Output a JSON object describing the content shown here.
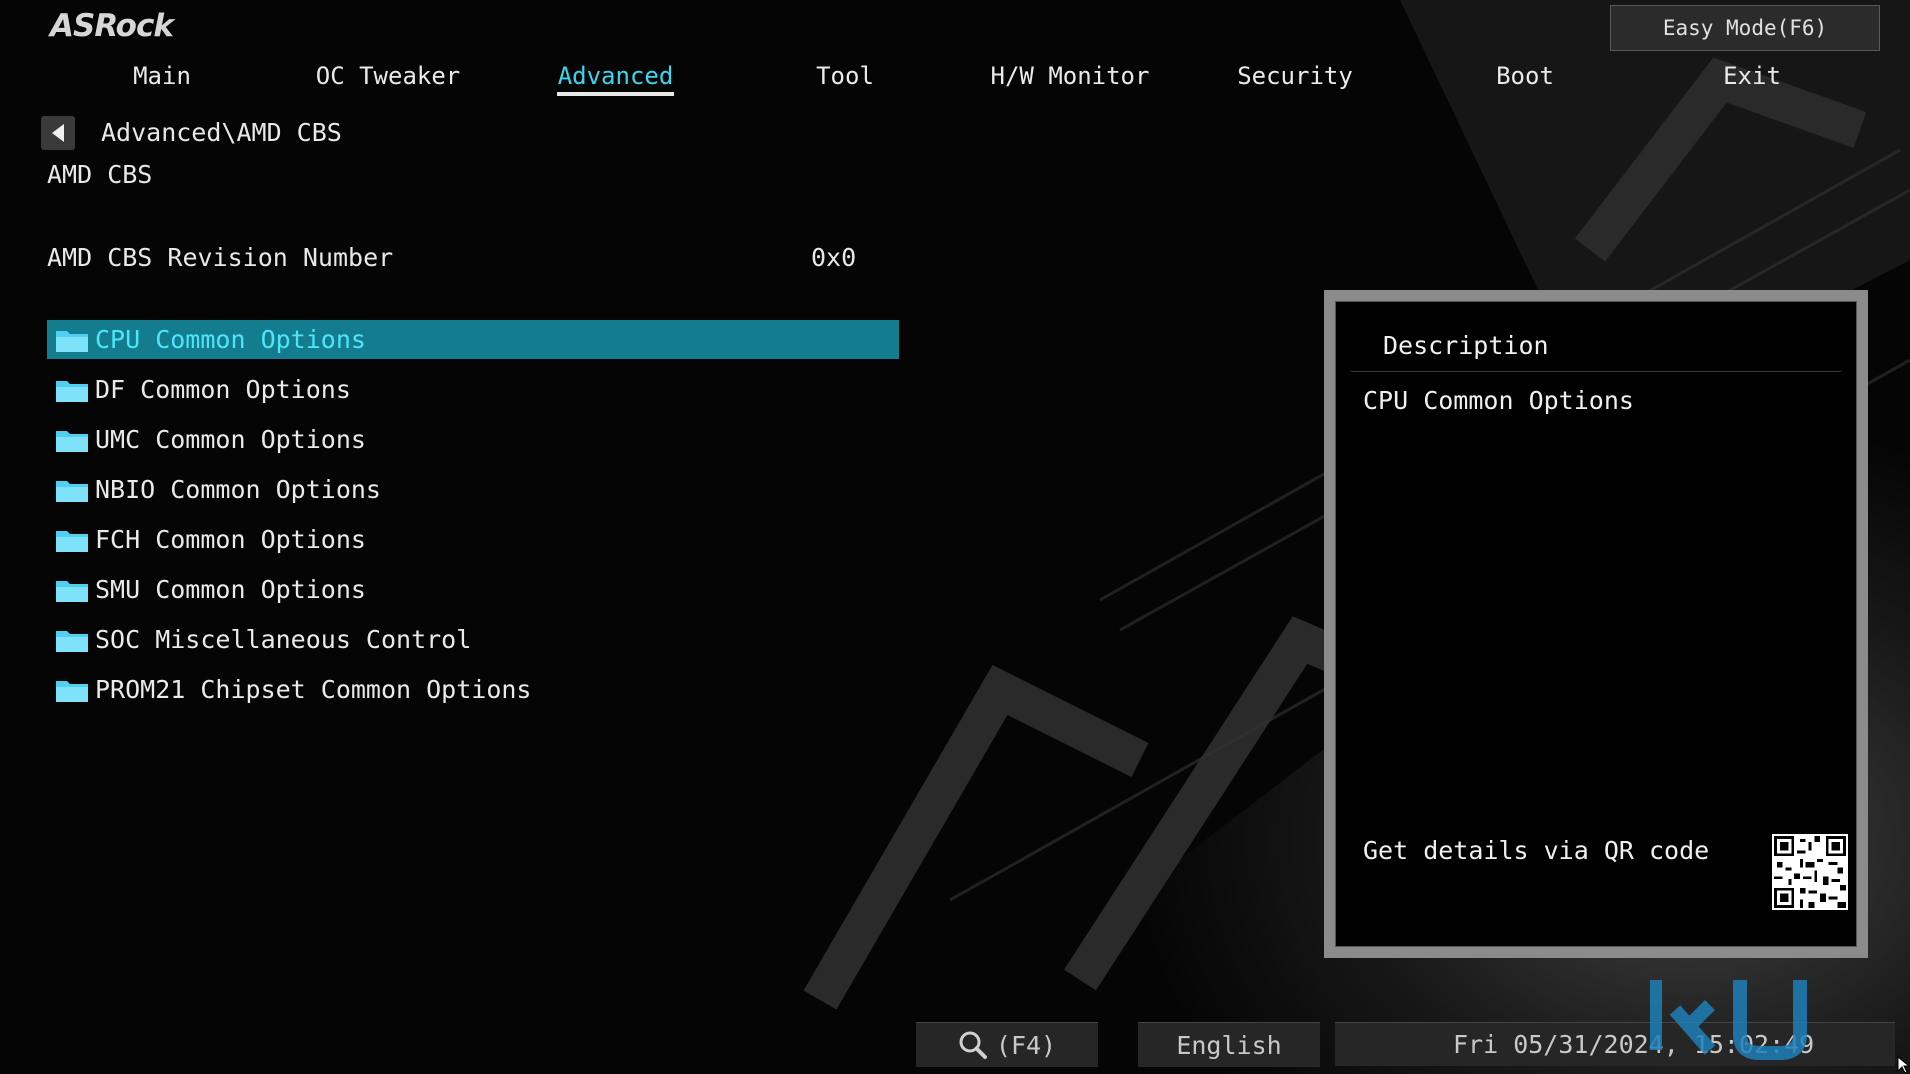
{
  "brand": {
    "logo": "ASRock"
  },
  "header": {
    "easy_mode": "Easy Mode(F6)"
  },
  "tabs": [
    {
      "label": "Main"
    },
    {
      "label": "OC Tweaker"
    },
    {
      "label": "Advanced",
      "active": true
    },
    {
      "label": "Tool"
    },
    {
      "label": "H/W Monitor"
    },
    {
      "label": "Security"
    },
    {
      "label": "Boot"
    },
    {
      "label": "Exit"
    }
  ],
  "breadcrumb": "Advanced\\AMD CBS",
  "section_title": "AMD CBS",
  "revision": {
    "label": "AMD CBS Revision Number",
    "value": "0x0"
  },
  "menu": [
    {
      "label": "CPU Common Options",
      "selected": true,
      "icon": "folder-icon"
    },
    {
      "label": "DF Common Options",
      "icon": "folder-icon"
    },
    {
      "label": "UMC Common Options",
      "icon": "folder-icon"
    },
    {
      "label": "NBIO Common Options",
      "icon": "folder-icon"
    },
    {
      "label": "FCH Common Options",
      "icon": "folder-icon"
    },
    {
      "label": "SMU Common Options",
      "icon": "folder-icon"
    },
    {
      "label": "SOC Miscellaneous Control",
      "icon": "folder-icon"
    },
    {
      "label": "PROM21 Chipset Common Options",
      "icon": "folder-icon"
    }
  ],
  "description": {
    "title": "Description",
    "text": "CPU Common Options",
    "qr_label": "Get details via QR code"
  },
  "footer": {
    "search": "(F4)",
    "language": "English",
    "datetime": "Fri 05/31/2024, 15:02:49"
  },
  "colors": {
    "accent": "#3ad6f0",
    "selected_bg": "#137d8f",
    "panel_border": "#8b8b8b"
  }
}
